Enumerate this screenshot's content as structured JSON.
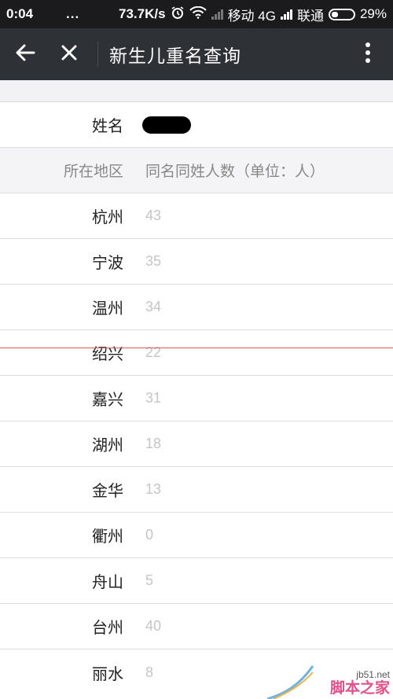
{
  "status_bar": {
    "time": "0:04",
    "dots": "...",
    "speed": "73.7K/s",
    "carrier1": "移动 4G",
    "carrier2": "联通",
    "battery": "29%"
  },
  "title_bar": {
    "title": "新生儿重名查询",
    "back_icon": "arrow-left-icon",
    "close_icon": "close-icon",
    "more_icon": "more-vertical-icon"
  },
  "name_row": {
    "label": "姓名"
  },
  "table": {
    "header_region": "所在地区",
    "header_count": "同名同姓人数（单位：人）",
    "rows": [
      {
        "region": "杭州",
        "count": "43"
      },
      {
        "region": "宁波",
        "count": "35"
      },
      {
        "region": "温州",
        "count": "34"
      },
      {
        "region": "绍兴",
        "count": "22"
      },
      {
        "region": "嘉兴",
        "count": "31"
      },
      {
        "region": "湖州",
        "count": "18"
      },
      {
        "region": "金华",
        "count": "13"
      },
      {
        "region": "衢州",
        "count": "0"
      },
      {
        "region": "舟山",
        "count": "5"
      },
      {
        "region": "台州",
        "count": "40"
      },
      {
        "region": "丽水",
        "count": "8"
      }
    ]
  },
  "watermark": {
    "url": "jb51.net",
    "name": "脚本之家"
  }
}
